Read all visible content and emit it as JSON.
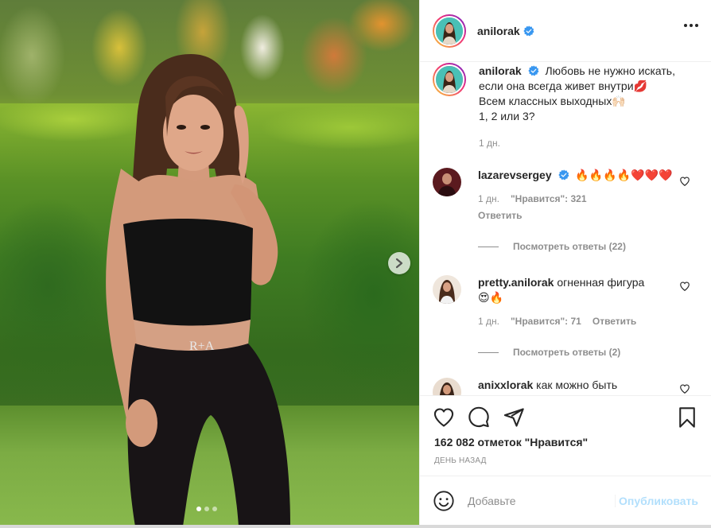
{
  "post": {
    "username": "anilorak",
    "photo_count": 3,
    "active_photo": 1
  },
  "caption": {
    "username": "anilorak",
    "lines": [
      "Любовь не нужно искать,",
      "если она всегда живет внутри💋",
      "Всем классных выходных🙌🏻",
      "1, 2 или 3?"
    ],
    "time": "1 дн."
  },
  "comments": [
    {
      "username": "lazarevsergey",
      "text": "🔥🔥🔥🔥❤️❤️❤️",
      "time": "1 дн.",
      "likes": "\"Нравится\": 321",
      "reply": "Ответить",
      "view_replies": "Посмотреть ответы (22)"
    },
    {
      "username": "pretty.anilorak",
      "text": "огненная фигура",
      "text2": "😍🔥",
      "time": "1 дн.",
      "likes": "\"Нравится\": 71",
      "reply": "Ответить",
      "view_replies": "Посмотреть ответы (2)"
    },
    {
      "username": "anixxlorak",
      "text": "как можно быть"
    }
  ],
  "stats": {
    "likes": "162 082 отметок \"Нравится\"",
    "posted": "ДЕНЬ НАЗАД"
  },
  "composer": {
    "placeholder": "Добавьте",
    "publish": "Опубликовать"
  },
  "icons": {
    "verified": "verified-badge-icon",
    "more": "more-options-icon",
    "like": "heart-icon",
    "comment": "comment-icon",
    "share": "paper-plane-icon",
    "save": "bookmark-icon",
    "emoji": "smiley-icon",
    "next": "chevron-right-icon"
  },
  "colors": {
    "verified": "#3897f0",
    "publish_disabled": "#b2dffc",
    "muted": "#8e8e8e"
  }
}
